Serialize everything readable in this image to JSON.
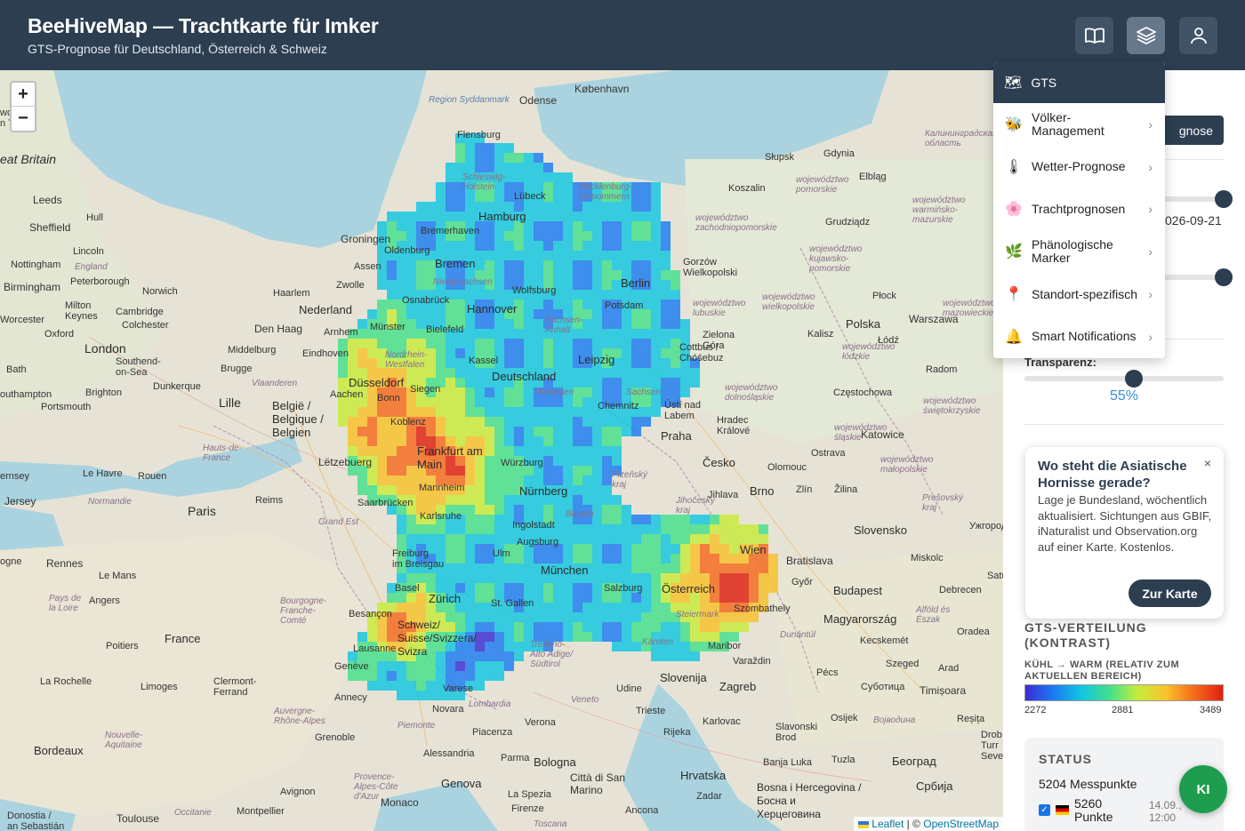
{
  "header": {
    "title": "BeeHiveMap — Trachtkarte für Imker",
    "subtitle": "GTS-Prognose für Deutschland, Österreich & Schweiz",
    "buttons": [
      {
        "name": "book-icon"
      },
      {
        "name": "layers-icon",
        "active": true
      },
      {
        "name": "user-icon"
      }
    ]
  },
  "map": {
    "zoom_in": "+",
    "zoom_out": "−",
    "labels": {
      "kobenhavn": "København",
      "great_britain": "eat Britain",
      "newcastle": "wcastle\nn Tyne",
      "leeds": "Leeds",
      "sheffield": "Sheffield",
      "hull": "Hull",
      "lincoln": "Lincoln",
      "nottingham": "Nottingham",
      "england": "England",
      "birmingham": "Birmingham",
      "peterborough": "Peterborough",
      "norwich": "Norwich",
      "milton": "Milton\nKeynes",
      "cambridge": "Cambridge",
      "colchester": "Colchester",
      "worcester": "Worcester",
      "oxford": "Oxford",
      "london": "London",
      "southend": "Southend-\non-Sea",
      "bath": "Bath",
      "brighton": "Brighton",
      "southampton": "outhampton",
      "portsmouth": "Portsmouth",
      "dunkerque": "Dunkerque",
      "lille": "Lille",
      "brugge": "Brugge",
      "vlaanderen": "Vlaanderen",
      "belgie": "België /\nBelgique /\nBelgien",
      "haarlem": "Haarlem",
      "nederland": "Nederland",
      "den_haag": "Den Haag",
      "arnhem": "Arnhem",
      "eindhoven": "Eindhoven",
      "middelburg": "Middelburg",
      "groningen": "Groningen",
      "assen": "Assen",
      "zwolle": "Zwolle",
      "aachen": "Aachen",
      "letzebuerg": "Lëtzebuerg",
      "paris": "Paris",
      "reims": "Reims",
      "rouen": "Rouen",
      "le_havre": "Le Havre",
      "hauts": "Hauts-de-\nFrance",
      "normandie": "Normandie",
      "grand_est": "Grand Est",
      "rennes": "Rennes",
      "le_mans": "Le Mans",
      "angers": "Angers",
      "pays_loire": "Pays de\nla Loire",
      "france": "France",
      "poitiers": "Poitiers",
      "la_rochelle": "La Rochelle",
      "limoges": "Limoges",
      "clermont": "Clermont-\nFerrand",
      "bourgogne": "Bourgogne-\nFranche-\nComté",
      "besancon": "Besançon",
      "geneve": "Genève",
      "lausanne": "Lausanne",
      "annecy": "Annecy",
      "auvergne": "Auvergne-\nRhône-Alpes",
      "nouvelle": "Nouvelle-\nAquitaine",
      "bordeaux": "Bordeaux",
      "grenoble": "Grenoble",
      "avignon": "Avignon",
      "provence": "Provence-\nAlpes-Côte\nd'Azur",
      "toulouse": "Toulouse",
      "occitanie": "Occitanie",
      "montpellier": "Montpellier",
      "monaco": "Monaco",
      "donostia": "Donostia /\nan Sebastián",
      "jersey": "Jersey",
      "ernsey": "ernsey",
      "ogne": "ogne",
      "regionsyd": "Region Syddanmark",
      "odense": "Odense",
      "flensburg": "Flensburg",
      "schleswig": "Schleswig-\nHolstein",
      "lubeck": "Lübeck",
      "mecklenburg": "Mecklenburg-\nVorpommern",
      "hamburg": "Hamburg",
      "bremerhaven": "Bremerhaven",
      "oldenburg": "Oldenburg",
      "bremen": "Bremen",
      "niedersachsen": "Niedersachsen",
      "osnabruck": "Osnabrück",
      "hannover": "Hannover",
      "wolfsburg": "Wolfsburg",
      "berlin": "Berlin",
      "potsdam": "Potsdam",
      "munster": "Münster",
      "bielefeld": "Bielefeld",
      "sachsen_anhalt": "Sachsen-\nAnhalt",
      "nordrhein": "Nordrhein-\nWestfalen",
      "dusseldorf": "Düsseldorf",
      "kassel": "Kassel",
      "leipzig": "Leipzig",
      "cottbus": "Cottbus /\nChóśebuz",
      "siegen": "Siegen",
      "deutschland": "Deutschland",
      "thuringen": "Thüringen",
      "sachsen": "Sachsen",
      "bonn": "Bonn",
      "chemnitz": "Chemnitz",
      "koblenz": "Koblenz",
      "frankfurt": "Frankfurt am\nMain",
      "wurzburg": "Würzburg",
      "mannheim": "Mannheim",
      "saarbrucken": "Saarbrücken",
      "nurnberg": "Nürnberg",
      "karlsruhe": "Karlsruhe",
      "ingolstadt": "Ingolstadt",
      "bayern": "Bayern",
      "augsburg": "Augsburg",
      "freiburg": "Freiburg\nim Breisgau",
      "ulm": "Ulm",
      "munchen": "München",
      "basel": "Basel",
      "zurich": "Zürich",
      "st_gallen": "St. Gallen",
      "salzburg": "Salzburg",
      "schweiz": "Schweiz/\nSuisse/Svizzera/\nSvizra",
      "trentino": "Trentino-\nAlto Adige/\nSüdtirol",
      "osterreich": "Österreich",
      "steiermark": "Steiermark",
      "karnten": "Kärnten",
      "wien": "Wien",
      "bratislava": "Bratislava",
      "gyor": "Győr",
      "szombathely": "Szombathely",
      "maribor": "Maribor",
      "budapest": "Budapest",
      "magyarorszag": "Magyarország",
      "kecskemet": "Kecskemét",
      "szeged": "Szeged",
      "varazdin": "Varaždin",
      "zagreb": "Zagreb",
      "pecs": "Pécs",
      "slovenija": "Slovenija",
      "udine": "Udine",
      "trieste": "Trieste",
      "rijeka": "Rijeka",
      "karlovac": "Karlovac",
      "hrvatska": "Hrvatska",
      "slavonski": "Slavonski\nBrod",
      "osijek": "Osijek",
      "banja_luka": "Banja Luka",
      "tuzla": "Tuzla",
      "bosna": "Bosna i Hercegovina /\nБосна и\nХерцеговина",
      "beograd": "Београд",
      "srbija": "Србија",
      "zadar": "Zadar",
      "novara": "Novara",
      "verona": "Verona",
      "lombardia": "Lombardia",
      "veneto": "Veneto",
      "piemonte": "Piemonte",
      "piacenza": "Piacenza",
      "alessandria": "Alessandria",
      "parma": "Parma",
      "bologna": "Bologna",
      "genova": "Genova",
      "la_spezia": "La Spezia",
      "firenze": "Firenze",
      "san_marino": "Città di San\nMarino",
      "ancona": "Ancona",
      "toscana": "Toscana",
      "varese": "Varese",
      "cesko": "Česko",
      "praha": "Praha",
      "usti": "Ústí nad\nLabem",
      "hradec": "Hradec\nKrálové",
      "plzensky": "Plzeňský\nkraj",
      "jihlava": "Jihlava",
      "jihocesky": "Jihočeský\nkraj",
      "brno": "Brno",
      "zlin": "Zlín",
      "olomouc": "Olomouc",
      "ostrava": "Ostrava",
      "katowice": "Katowice",
      "zilina": "Žilina",
      "slovensko": "Slovensko",
      "presovsky": "Prešovský\nkraj",
      "uzhorod": "Ужгород",
      "miskolc": "Miskolc",
      "debrecen": "Debrecen",
      "oradea": "Oradea",
      "timisoara": "Timișoara",
      "subotica": "Суботица",
      "arad": "Arad",
      "resita": "Reșița",
      "alfold": "Alföld és\nÉszak",
      "dunantul": "Dunántúl",
      "vojvodina": "Војводина",
      "polska": "Polska",
      "warszawa": "Warszawa",
      "lodz": "Łódź",
      "radom": "Radom",
      "czestochowa": "Częstochowa",
      "kalisz": "Kalisz",
      "plock": "Płock",
      "poznan": "Gorzów\nWielkopolski",
      "zielona": "Zielona\nGóra",
      "koszalin": "Koszalin",
      "slupsk": "Słupsk",
      "gdynia": "Gdynia",
      "elblag": "Elbląg",
      "grudziadz": "Grudziądz",
      "kaliningrad": "Калининградская\nобласть",
      "wroclaw_reg": "województwo\ndolnośląskie",
      "swietokrzyskie": "województwo\nświętokrzyskie",
      "malopolskie": "województwo\nmałopolskie",
      "lubuskie": "województwo\nlubuskie",
      "wielkopolskie": "województwo\nwielkopolskie",
      "lodzkie": "województwo\nłódzkie",
      "kujawsko": "województwo\nkujawsko-\npomorskie",
      "pomorskie": "województwo\npomorskie",
      "zachodniopomorskie": "województwo\nzachodniopomorskie",
      "warminsko": "województwo\nwarmińsko-\nmazurskie",
      "mazowieckie": "województwo\nmazowieckie",
      "slaskie": "województwo\nśląskie",
      "drob": "Drob\nTurr\nSeve",
      "satu": "Satu"
    },
    "attribution": {
      "leaflet": "Leaflet",
      "sep": " | © ",
      "osm": "OpenStreetMap"
    }
  },
  "dropdown": {
    "header": {
      "icon": "map-icon",
      "label": "GTS"
    },
    "items": [
      {
        "icon": "bee-icon",
        "glyph": "🐝",
        "label": "Völker-\nManagement"
      },
      {
        "icon": "thermometer-icon",
        "glyph": "🌡",
        "label": "Wetter-Prognose"
      },
      {
        "icon": "flower-icon",
        "glyph": "🌸",
        "label": "Trachtprognosen"
      },
      {
        "icon": "leaf-icon",
        "glyph": "🌿",
        "label": "Phänologische\nMarker"
      },
      {
        "icon": "pin-icon",
        "glyph": "📍",
        "label": "Standort-spezifisch"
      },
      {
        "icon": "bell-icon",
        "glyph": "🔔",
        "label": "Smart Notifications"
      }
    ],
    "chevron": "›"
  },
  "panel": {
    "prognose_button": "gnose",
    "date_value": "026-09-21",
    "slider1_value": 1.0,
    "slider2_value": 1.0,
    "transparency_label": "Transparenz:",
    "transparency_value": "55%",
    "transparency_fraction": 0.55
  },
  "popup": {
    "title": "Wo steht die Asiatische Hornisse gerade?",
    "close": "×",
    "text": "Lage je Bundesland, wöchentlich aktualisiert. Sichtungen aus GBIF, iNaturalist und Observation.org auf einer Karte. Kostenlos.",
    "button": "Zur Karte"
  },
  "distribution": {
    "title": "GTS-VERTEILUNG (KONTRAST)",
    "subtitle": "KÜHL → WARM (RELATIV ZUM AKTUELLEN BEREICH)",
    "min": "2272",
    "mid": "2881",
    "max": "3489"
  },
  "status": {
    "title": "STATUS",
    "count": "5204 Messpunkte",
    "row": {
      "checkbox": "✓",
      "points": "5260\nPunkte",
      "time": "14.09.,\n12:00"
    }
  },
  "ki_button": "KI",
  "colors": {
    "header_bg": "#2c3e50",
    "accent_blue": "#3a8fd6",
    "ki_green": "#1f9d4f"
  }
}
